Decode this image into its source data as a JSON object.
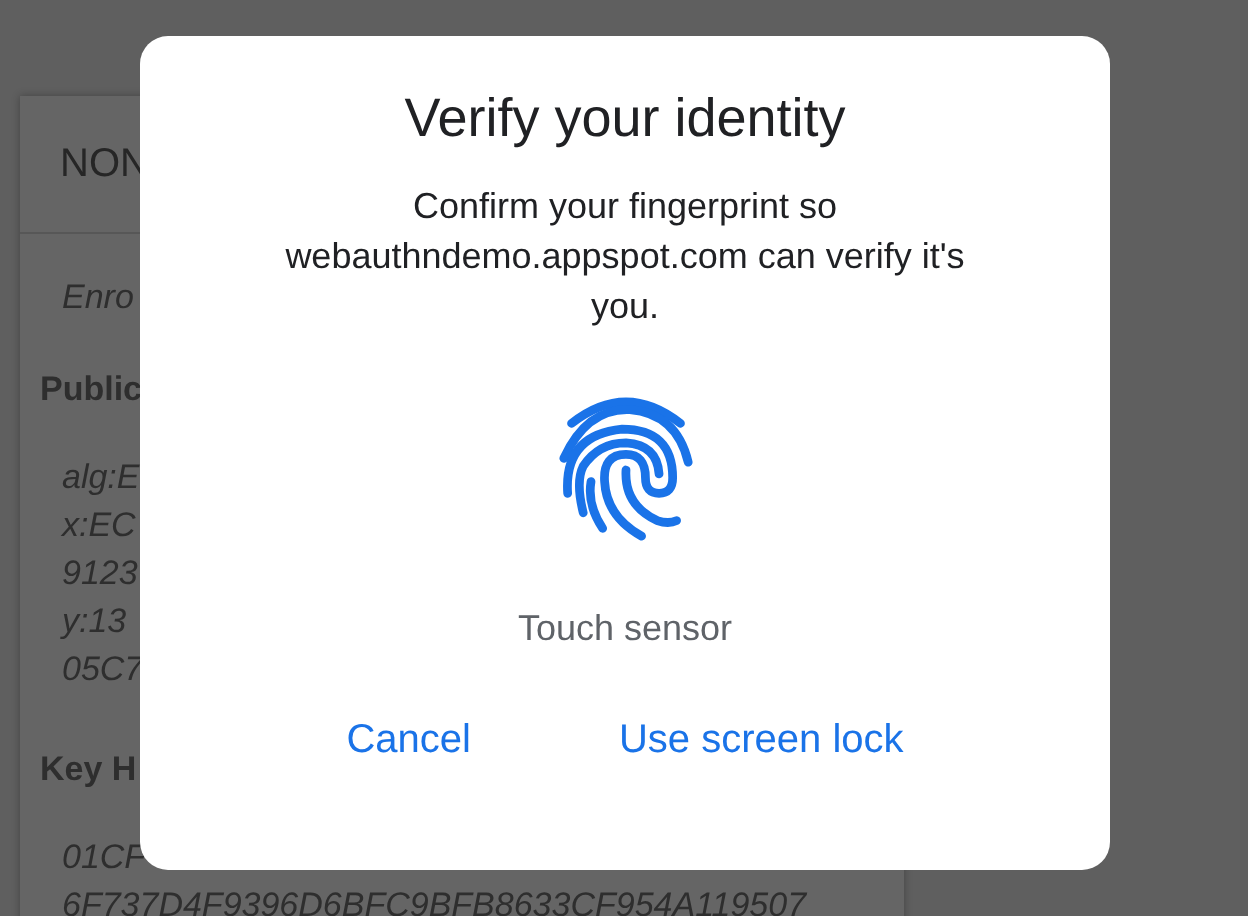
{
  "background_card": {
    "title": "NON",
    "lines": [
      {
        "kind": "note",
        "text": "Enro"
      },
      {
        "kind": "heading",
        "text": "Public"
      },
      {
        "kind": "value",
        "text": "alg:E"
      },
      {
        "kind": "value",
        "text": "x:EC"
      },
      {
        "kind": "value",
        "text": "9123"
      },
      {
        "kind": "value",
        "text": "y:13"
      },
      {
        "kind": "value",
        "text": "05C7"
      },
      {
        "kind": "heading",
        "text": "Key H"
      },
      {
        "kind": "value",
        "text": "01CF"
      },
      {
        "kind": "value",
        "text": "6F737D4F9396D6BFC9BFB8633CF954A119507"
      }
    ]
  },
  "dialog": {
    "title": "Verify your identity",
    "message": "Confirm your fingerprint so webauthndemo.appspot.com can verify it's you.",
    "hint": "Touch sensor",
    "buttons": [
      "Cancel",
      "Use screen lock"
    ]
  }
}
